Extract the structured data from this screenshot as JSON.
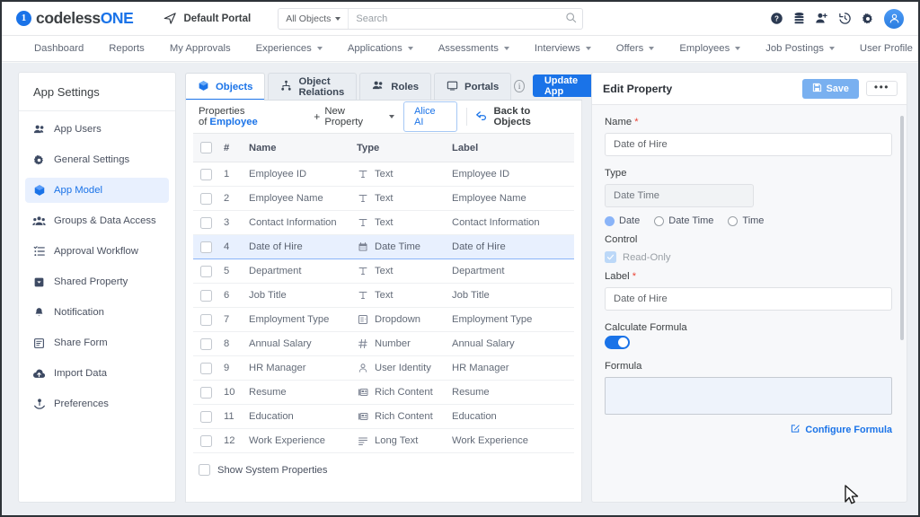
{
  "header": {
    "brand_mark": "1",
    "brand_text_dark": "codeless",
    "brand_text_accent": "ONE",
    "portal_label": "Default Portal",
    "portal_icon": "paper-plane-icon",
    "search_scope": "All Objects",
    "search_placeholder": "Search",
    "search_value": "",
    "icons": [
      "help-icon",
      "database-icon",
      "add-user-icon",
      "history-icon",
      "gear-icon",
      "avatar"
    ],
    "accent_color": "#1a73e8"
  },
  "menubar": {
    "items": [
      {
        "label": "Dashboard",
        "has_caret": false
      },
      {
        "label": "Reports",
        "has_caret": false
      },
      {
        "label": "My Approvals",
        "has_caret": false
      },
      {
        "label": "Experiences",
        "has_caret": true
      },
      {
        "label": "Applications",
        "has_caret": true
      },
      {
        "label": "Assessments",
        "has_caret": true
      },
      {
        "label": "Interviews",
        "has_caret": true
      },
      {
        "label": "Offers",
        "has_caret": true
      },
      {
        "label": "Employees",
        "has_caret": true
      },
      {
        "label": "Job Postings",
        "has_caret": true
      },
      {
        "label": "User Profile",
        "has_caret": true
      }
    ]
  },
  "sidebar": {
    "title": "App Settings",
    "items": [
      {
        "label": "App Users",
        "icon": "users-icon",
        "active": false
      },
      {
        "label": "General Settings",
        "icon": "gear-icon",
        "active": false
      },
      {
        "label": "App Model",
        "icon": "cube-icon",
        "active": true
      },
      {
        "label": "Groups & Data Access",
        "icon": "group-users-icon",
        "active": false
      },
      {
        "label": "Approval Workflow",
        "icon": "checklist-icon",
        "active": false
      },
      {
        "label": "Shared Property",
        "icon": "tag-icon",
        "active": false
      },
      {
        "label": "Notification",
        "icon": "bell-icon",
        "active": false
      },
      {
        "label": "Share Form",
        "icon": "form-icon",
        "active": false
      },
      {
        "label": "Import Data",
        "icon": "cloud-upload-icon",
        "active": false
      },
      {
        "label": "Preferences",
        "icon": "preferences-icon",
        "active": false
      }
    ]
  },
  "tabs": [
    {
      "label": "Objects",
      "icon": "cube-icon",
      "active": true
    },
    {
      "label": "Object Relations",
      "icon": "relations-icon",
      "active": false
    },
    {
      "label": "Roles",
      "icon": "users-icon",
      "active": false
    },
    {
      "label": "Portals",
      "icon": "monitor-icon",
      "active": false
    }
  ],
  "tabs_right": {
    "info_icon": "info-icon",
    "update_app_label": "Update App"
  },
  "prop_toolbar": {
    "properties_of": "Properties of",
    "object_name": "Employee",
    "new_property_label": "New Property",
    "alice_ai_label": "Alice AI",
    "back_label": "Back to Objects"
  },
  "table": {
    "columns": [
      "",
      "#",
      "Name",
      "Type",
      "Label"
    ],
    "rows": [
      {
        "num": "1",
        "name": "Employee ID",
        "type": "Text",
        "type_icon": "text-icon",
        "label": "Employee ID",
        "selected": false
      },
      {
        "num": "2",
        "name": "Employee Name",
        "type": "Text",
        "type_icon": "text-icon",
        "label": "Employee Name",
        "selected": false
      },
      {
        "num": "3",
        "name": "Contact Information",
        "type": "Text",
        "type_icon": "text-icon",
        "label": "Contact Information",
        "selected": false
      },
      {
        "num": "4",
        "name": "Date of Hire",
        "type": "Date Time",
        "type_icon": "calendar-icon",
        "label": "Date of Hire",
        "selected": true
      },
      {
        "num": "5",
        "name": "Department",
        "type": "Text",
        "type_icon": "text-icon",
        "label": "Department",
        "selected": false
      },
      {
        "num": "6",
        "name": "Job Title",
        "type": "Text",
        "type_icon": "text-icon",
        "label": "Job Title",
        "selected": false
      },
      {
        "num": "7",
        "name": "Employment Type",
        "type": "Dropdown",
        "type_icon": "dropdown-icon",
        "label": "Employment Type",
        "selected": false
      },
      {
        "num": "8",
        "name": "Annual Salary",
        "type": "Number",
        "type_icon": "number-icon",
        "label": "Annual Salary",
        "selected": false
      },
      {
        "num": "9",
        "name": "HR Manager",
        "type": "User Identity",
        "type_icon": "user-icon",
        "label": "HR Manager",
        "selected": false
      },
      {
        "num": "10",
        "name": "Resume",
        "type": "Rich Content",
        "type_icon": "rich-content-icon",
        "label": "Resume",
        "selected": false
      },
      {
        "num": "11",
        "name": "Education",
        "type": "Rich Content",
        "type_icon": "rich-content-icon",
        "label": "Education",
        "selected": false
      },
      {
        "num": "12",
        "name": "Work Experience",
        "type": "Long Text",
        "type_icon": "long-text-icon",
        "label": "Work Experience",
        "selected": false
      }
    ],
    "show_system_properties": "Show System Properties"
  },
  "edit_panel": {
    "title": "Edit Property",
    "save_label": "Save",
    "more_label": "•••",
    "name_label": "Name",
    "name_value": "Date of Hire",
    "type_label": "Type",
    "type_value": "Date Time",
    "type_options": [
      {
        "label": "Date",
        "selected": true
      },
      {
        "label": "Date Time",
        "selected": false
      },
      {
        "label": "Time",
        "selected": false
      }
    ],
    "control_label": "Control",
    "readonly_label": "Read-Only",
    "readonly_checked": true,
    "label_label": "Label",
    "label_value": "Date of Hire",
    "calculate_formula_label": "Calculate Formula",
    "calculate_formula_on": true,
    "formula_label": "Formula",
    "formula_value": "",
    "configure_formula_label": "Configure Formula"
  }
}
